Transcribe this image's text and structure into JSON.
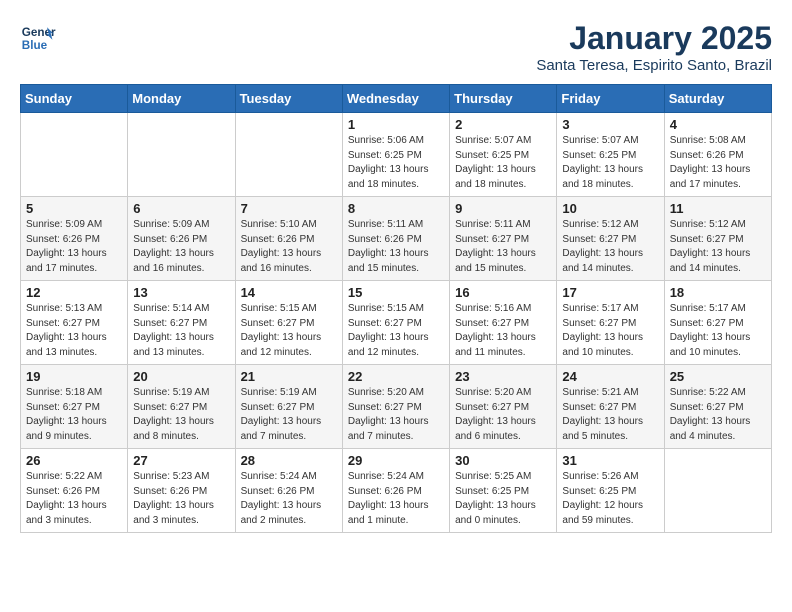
{
  "header": {
    "logo_line1": "General",
    "logo_line2": "Blue",
    "title": "January 2025",
    "subtitle": "Santa Teresa, Espirito Santo, Brazil"
  },
  "weekdays": [
    "Sunday",
    "Monday",
    "Tuesday",
    "Wednesday",
    "Thursday",
    "Friday",
    "Saturday"
  ],
  "weeks": [
    [
      {
        "day": "",
        "info": ""
      },
      {
        "day": "",
        "info": ""
      },
      {
        "day": "",
        "info": ""
      },
      {
        "day": "1",
        "info": "Sunrise: 5:06 AM\nSunset: 6:25 PM\nDaylight: 13 hours\nand 18 minutes."
      },
      {
        "day": "2",
        "info": "Sunrise: 5:07 AM\nSunset: 6:25 PM\nDaylight: 13 hours\nand 18 minutes."
      },
      {
        "day": "3",
        "info": "Sunrise: 5:07 AM\nSunset: 6:25 PM\nDaylight: 13 hours\nand 18 minutes."
      },
      {
        "day": "4",
        "info": "Sunrise: 5:08 AM\nSunset: 6:26 PM\nDaylight: 13 hours\nand 17 minutes."
      }
    ],
    [
      {
        "day": "5",
        "info": "Sunrise: 5:09 AM\nSunset: 6:26 PM\nDaylight: 13 hours\nand 17 minutes."
      },
      {
        "day": "6",
        "info": "Sunrise: 5:09 AM\nSunset: 6:26 PM\nDaylight: 13 hours\nand 16 minutes."
      },
      {
        "day": "7",
        "info": "Sunrise: 5:10 AM\nSunset: 6:26 PM\nDaylight: 13 hours\nand 16 minutes."
      },
      {
        "day": "8",
        "info": "Sunrise: 5:11 AM\nSunset: 6:26 PM\nDaylight: 13 hours\nand 15 minutes."
      },
      {
        "day": "9",
        "info": "Sunrise: 5:11 AM\nSunset: 6:27 PM\nDaylight: 13 hours\nand 15 minutes."
      },
      {
        "day": "10",
        "info": "Sunrise: 5:12 AM\nSunset: 6:27 PM\nDaylight: 13 hours\nand 14 minutes."
      },
      {
        "day": "11",
        "info": "Sunrise: 5:12 AM\nSunset: 6:27 PM\nDaylight: 13 hours\nand 14 minutes."
      }
    ],
    [
      {
        "day": "12",
        "info": "Sunrise: 5:13 AM\nSunset: 6:27 PM\nDaylight: 13 hours\nand 13 minutes."
      },
      {
        "day": "13",
        "info": "Sunrise: 5:14 AM\nSunset: 6:27 PM\nDaylight: 13 hours\nand 13 minutes."
      },
      {
        "day": "14",
        "info": "Sunrise: 5:15 AM\nSunset: 6:27 PM\nDaylight: 13 hours\nand 12 minutes."
      },
      {
        "day": "15",
        "info": "Sunrise: 5:15 AM\nSunset: 6:27 PM\nDaylight: 13 hours\nand 12 minutes."
      },
      {
        "day": "16",
        "info": "Sunrise: 5:16 AM\nSunset: 6:27 PM\nDaylight: 13 hours\nand 11 minutes."
      },
      {
        "day": "17",
        "info": "Sunrise: 5:17 AM\nSunset: 6:27 PM\nDaylight: 13 hours\nand 10 minutes."
      },
      {
        "day": "18",
        "info": "Sunrise: 5:17 AM\nSunset: 6:27 PM\nDaylight: 13 hours\nand 10 minutes."
      }
    ],
    [
      {
        "day": "19",
        "info": "Sunrise: 5:18 AM\nSunset: 6:27 PM\nDaylight: 13 hours\nand 9 minutes."
      },
      {
        "day": "20",
        "info": "Sunrise: 5:19 AM\nSunset: 6:27 PM\nDaylight: 13 hours\nand 8 minutes."
      },
      {
        "day": "21",
        "info": "Sunrise: 5:19 AM\nSunset: 6:27 PM\nDaylight: 13 hours\nand 7 minutes."
      },
      {
        "day": "22",
        "info": "Sunrise: 5:20 AM\nSunset: 6:27 PM\nDaylight: 13 hours\nand 7 minutes."
      },
      {
        "day": "23",
        "info": "Sunrise: 5:20 AM\nSunset: 6:27 PM\nDaylight: 13 hours\nand 6 minutes."
      },
      {
        "day": "24",
        "info": "Sunrise: 5:21 AM\nSunset: 6:27 PM\nDaylight: 13 hours\nand 5 minutes."
      },
      {
        "day": "25",
        "info": "Sunrise: 5:22 AM\nSunset: 6:27 PM\nDaylight: 13 hours\nand 4 minutes."
      }
    ],
    [
      {
        "day": "26",
        "info": "Sunrise: 5:22 AM\nSunset: 6:26 PM\nDaylight: 13 hours\nand 3 minutes."
      },
      {
        "day": "27",
        "info": "Sunrise: 5:23 AM\nSunset: 6:26 PM\nDaylight: 13 hours\nand 3 minutes."
      },
      {
        "day": "28",
        "info": "Sunrise: 5:24 AM\nSunset: 6:26 PM\nDaylight: 13 hours\nand 2 minutes."
      },
      {
        "day": "29",
        "info": "Sunrise: 5:24 AM\nSunset: 6:26 PM\nDaylight: 13 hours\nand 1 minute."
      },
      {
        "day": "30",
        "info": "Sunrise: 5:25 AM\nSunset: 6:25 PM\nDaylight: 13 hours\nand 0 minutes."
      },
      {
        "day": "31",
        "info": "Sunrise: 5:26 AM\nSunset: 6:25 PM\nDaylight: 12 hours\nand 59 minutes."
      },
      {
        "day": "",
        "info": ""
      }
    ]
  ]
}
